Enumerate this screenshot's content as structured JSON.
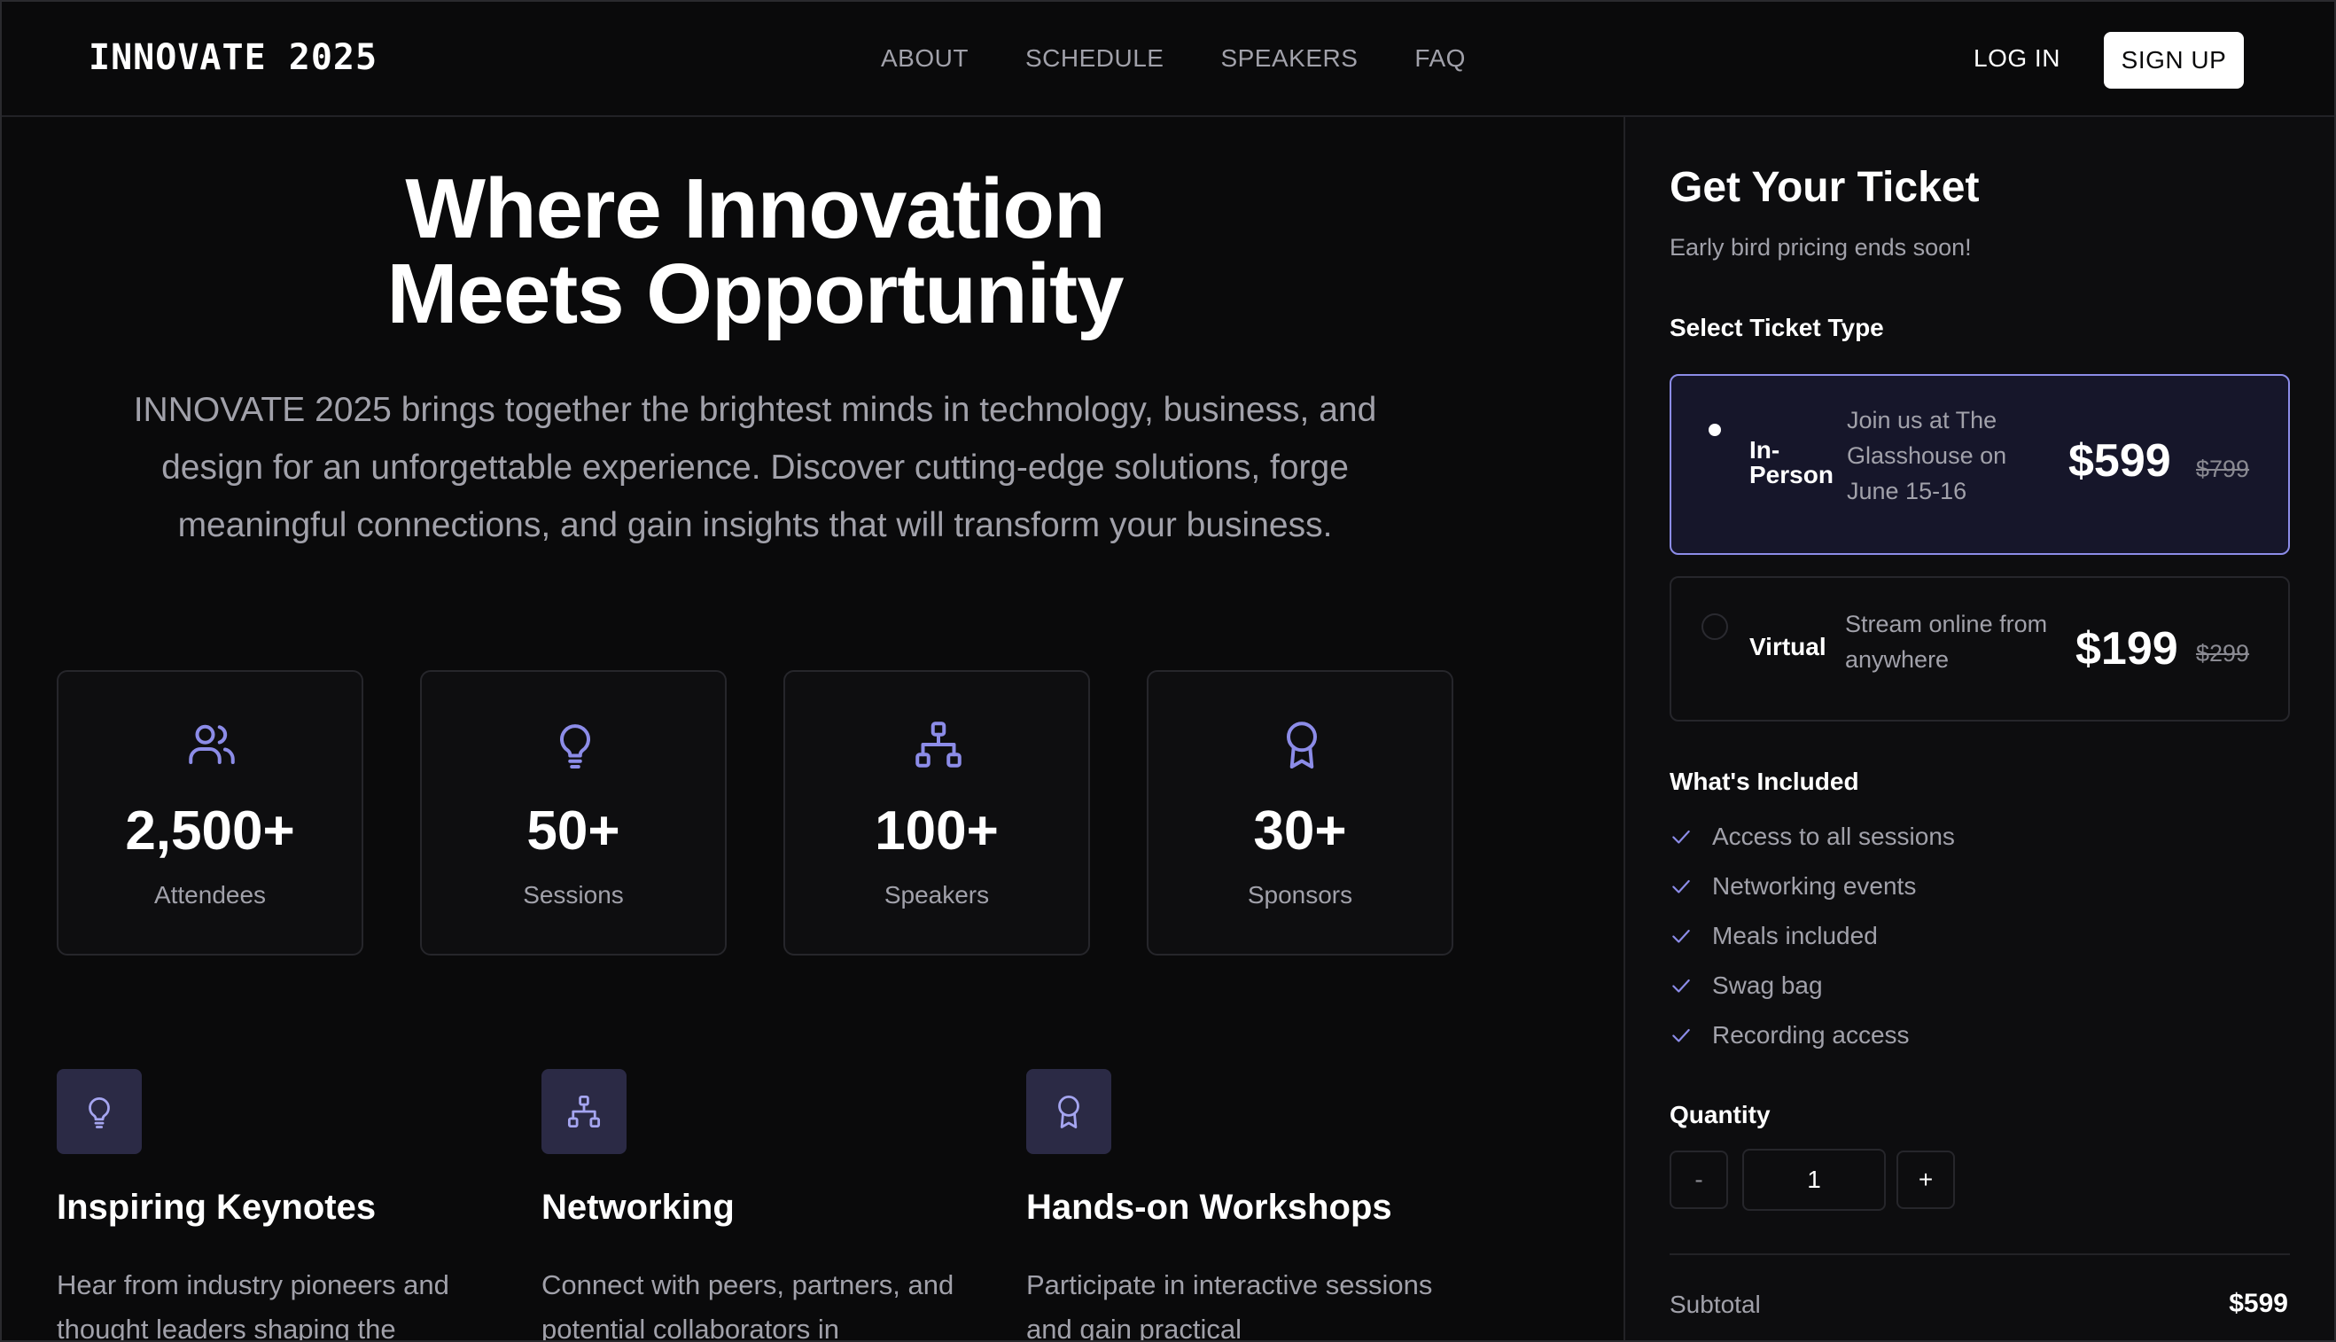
{
  "nav": {
    "brand": "INNOVATE 2025",
    "links": [
      "ABOUT",
      "SCHEDULE",
      "SPEAKERS",
      "FAQ"
    ],
    "login": "LOG IN",
    "signup": "SIGN UP"
  },
  "hero": {
    "title_line1": "Where Innovation",
    "title_line2": "Meets Opportunity",
    "description": "INNOVATE 2025 brings together the brightest minds in technology, business, and design for an unforgettable experience. Discover cutting-edge solutions, forge meaningful connections, and gain insights that will transform your business."
  },
  "stats": [
    {
      "icon": "users-icon",
      "value": "2,500+",
      "label": "Attendees"
    },
    {
      "icon": "lightbulb-icon",
      "value": "50+",
      "label": "Sessions"
    },
    {
      "icon": "network-icon",
      "value": "100+",
      "label": "Speakers"
    },
    {
      "icon": "award-icon",
      "value": "30+",
      "label": "Sponsors"
    }
  ],
  "features": [
    {
      "icon": "lightbulb-icon",
      "title": "Inspiring Keynotes",
      "description": "Hear from industry pioneers and thought leaders shaping the"
    },
    {
      "icon": "network-icon",
      "title": "Networking",
      "description": "Connect with peers, partners, and potential collaborators in"
    },
    {
      "icon": "award-icon",
      "title": "Hands-on Workshops",
      "description": "Participate in interactive sessions and gain practical"
    }
  ],
  "ticket": {
    "title": "Get Your Ticket",
    "subtitle": "Early bird pricing ends soon!",
    "select_label": "Select Ticket Type",
    "options": [
      {
        "name_line1": "In-",
        "name_line2": "Person",
        "description": "Join us at The Glasshouse on June 15-16",
        "price": "$599",
        "old_price": "$799",
        "selected": true
      },
      {
        "name": "Virtual",
        "description": "Stream online from anywhere",
        "price": "$199",
        "old_price": "$299",
        "selected": false
      }
    ],
    "included_label": "What's Included",
    "included": [
      "Access to all sessions",
      "Networking events",
      "Meals included",
      "Swag bag",
      "Recording access"
    ],
    "quantity_label": "Quantity",
    "quantity_minus": "-",
    "quantity_plus": "+",
    "quantity_value": "1",
    "subtotal_label": "Subtotal",
    "subtotal_value": "$599"
  },
  "colors": {
    "background": "#0a0a0b",
    "accent": "#8c8ce8",
    "icon_tile": "#2b2a45",
    "muted_text": "#a1a1aa"
  }
}
